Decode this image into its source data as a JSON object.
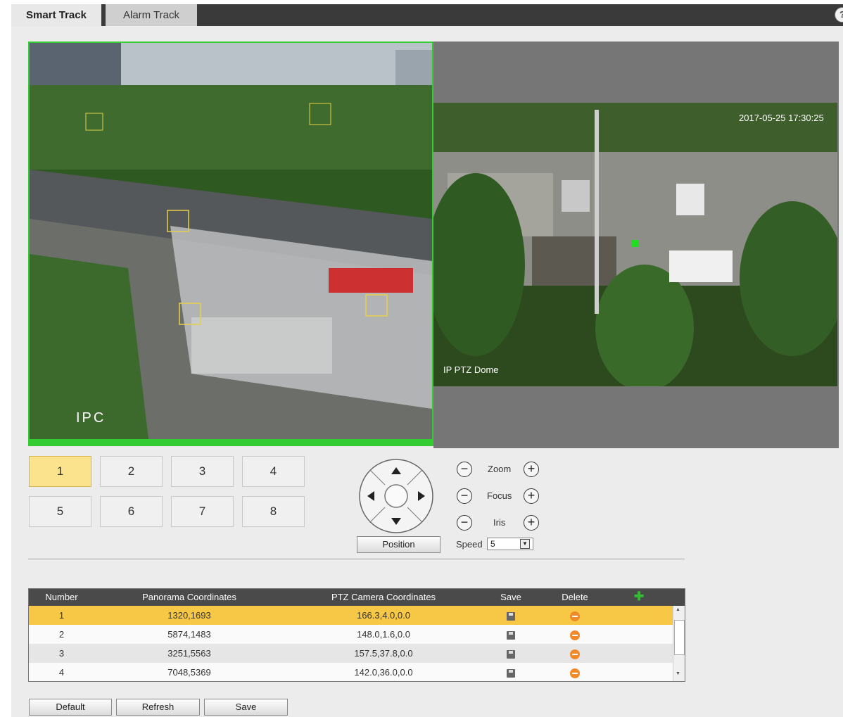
{
  "tabs": {
    "smart_track": "Smart Track",
    "alarm_track": "Alarm Track"
  },
  "help_icon": "?",
  "video": {
    "ipc_label": "IPC",
    "ptz_label": "IP PTZ Dome",
    "timestamp": "2017-05-25 17:30:25"
  },
  "presets": [
    "1",
    "2",
    "3",
    "4",
    "5",
    "6",
    "7",
    "8"
  ],
  "active_preset": "1",
  "controls": {
    "zoom": "Zoom",
    "focus": "Focus",
    "iris": "Iris",
    "minus": "−",
    "plus": "+",
    "position_button": "Position",
    "speed_label": "Speed",
    "speed_value": "5"
  },
  "table": {
    "headers": {
      "number": "Number",
      "panorama": "Panorama Coordinates",
      "ptz": "PTZ Camera Coordinates",
      "save": "Save",
      "delete": "Delete"
    },
    "rows": [
      {
        "number": "1",
        "panorama": "1320,1693",
        "ptz": "166.3,4.0,0.0"
      },
      {
        "number": "2",
        "panorama": "5874,1483",
        "ptz": "148.0,1.6,0.0"
      },
      {
        "number": "3",
        "panorama": "3251,5563",
        "ptz": "157.5,37.8,0.0"
      },
      {
        "number": "4",
        "panorama": "7048,5369",
        "ptz": "142.0,36.0,0.0"
      }
    ]
  },
  "buttons": {
    "default": "Default",
    "refresh": "Refresh",
    "save": "Save"
  },
  "colors": {
    "active_row": "#f6c846",
    "tracking_border": "#33cc33",
    "delete_icon": "#f28a2a",
    "add_icon": "#33bb33"
  }
}
